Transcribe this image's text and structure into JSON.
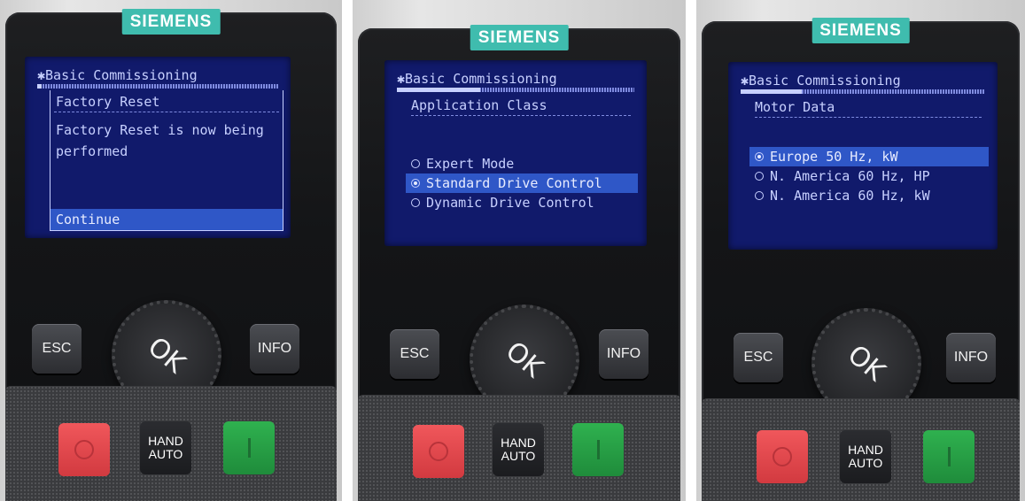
{
  "panels": [
    {
      "brand": "SIEMENS",
      "menu_title": "Basic Commissioning",
      "progress": 0.02,
      "heading": "Factory Reset",
      "message_lines": [
        "Factory Reset is now being",
        "performed"
      ],
      "action_label": "Continue",
      "buttons": {
        "esc": "ESC",
        "ok": "OK",
        "info": "INFO",
        "hand": "HAND",
        "auto": "AUTO"
      }
    },
    {
      "brand": "SIEMENS",
      "menu_title": "Basic Commissioning",
      "progress": 0.35,
      "heading": "Application Class",
      "options": [
        {
          "label": "Expert Mode",
          "selected": false
        },
        {
          "label": "Standard Drive Control",
          "selected": true
        },
        {
          "label": "Dynamic Drive Control",
          "selected": false
        }
      ],
      "buttons": {
        "esc": "ESC",
        "ok": "OK",
        "info": "INFO",
        "hand": "HAND",
        "auto": "AUTO"
      }
    },
    {
      "brand": "SIEMENS",
      "menu_title": "Basic Commissioning",
      "progress": 0.25,
      "heading": "Motor Data",
      "options": [
        {
          "label": "Europe 50 Hz, kW",
          "selected": true
        },
        {
          "label": "N. America 60 Hz, HP",
          "selected": false
        },
        {
          "label": "N. America 60 Hz, kW",
          "selected": false
        }
      ],
      "buttons": {
        "esc": "ESC",
        "ok": "OK",
        "info": "INFO",
        "hand": "HAND",
        "auto": "AUTO"
      }
    }
  ],
  "colors": {
    "brand": "#3fbcae",
    "screen": "#111a6b",
    "highlight": "#2f57c7",
    "off_key": "#e0474c",
    "on_key": "#28a046"
  }
}
